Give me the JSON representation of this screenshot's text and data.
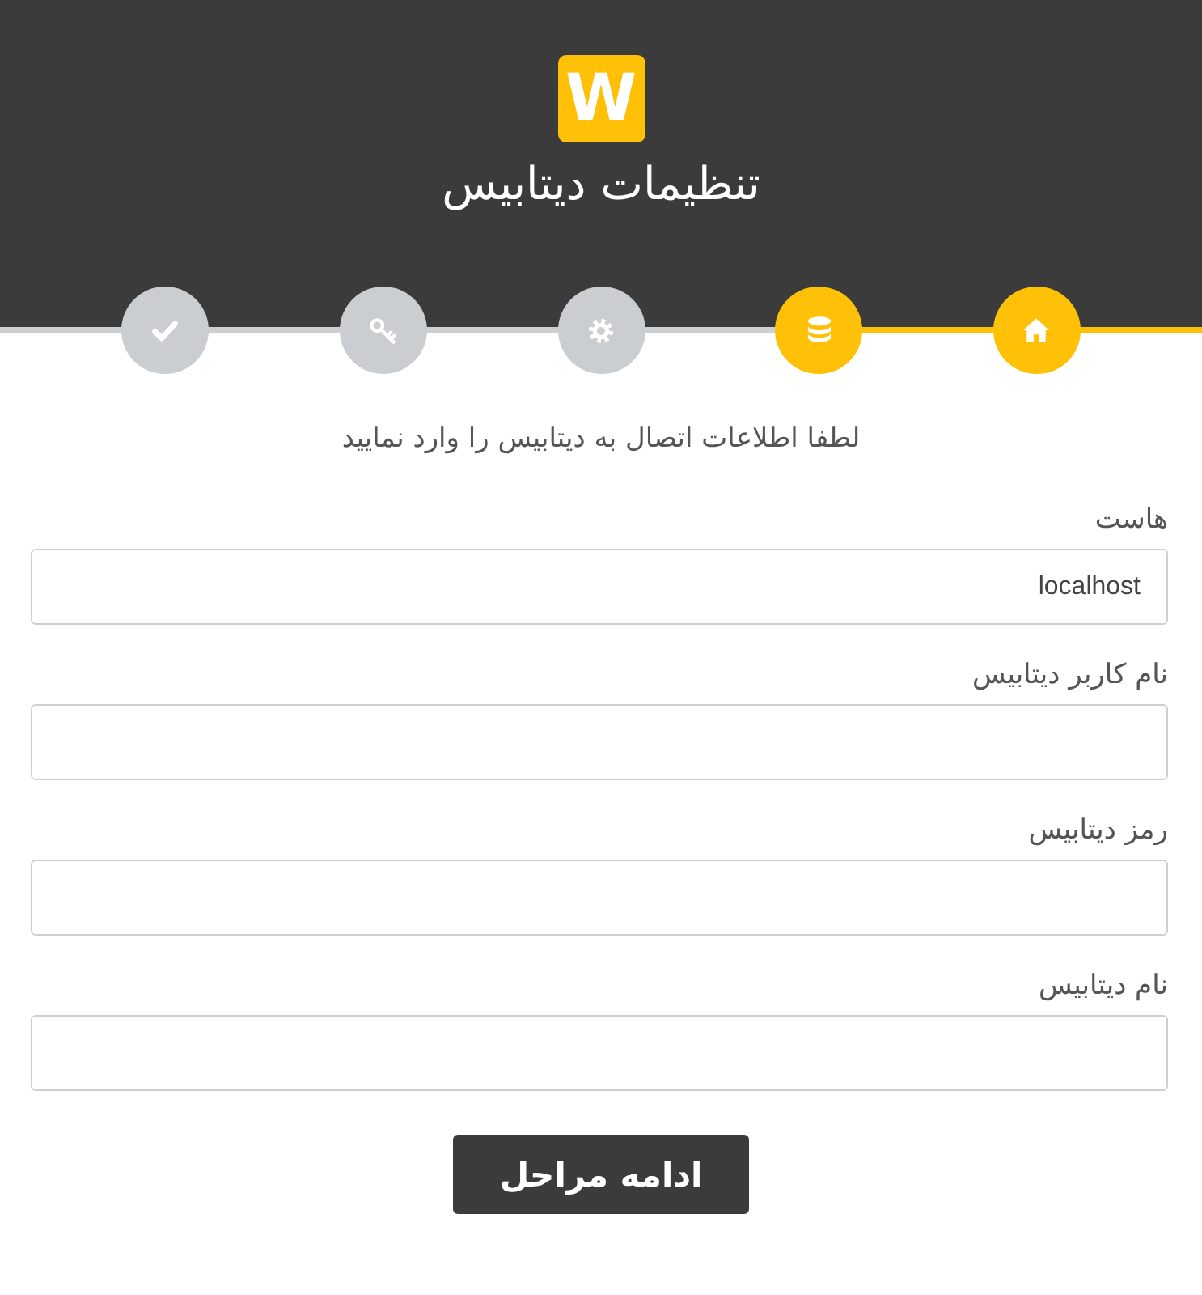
{
  "header": {
    "logo": {
      "mark": "W"
    },
    "title": "تنظیمات دیتابیس"
  },
  "steps": [
    {
      "kind": "home",
      "active": true
    },
    {
      "kind": "database",
      "active": true
    },
    {
      "kind": "gear",
      "active": false
    },
    {
      "kind": "key",
      "active": false
    },
    {
      "kind": "check",
      "active": false
    }
  ],
  "intro": "لطفا اطلاعات اتصال به دیتابیس را وارد نمایید",
  "fields": [
    {
      "label": "هاست",
      "value": "localhost"
    },
    {
      "label": "نام کاربر دیتابیس"
    },
    {
      "label": "رمز دیتابیس"
    },
    {
      "label": "نام دیتابیس"
    }
  ],
  "submit": {
    "label": "ادامه مراحل"
  }
}
